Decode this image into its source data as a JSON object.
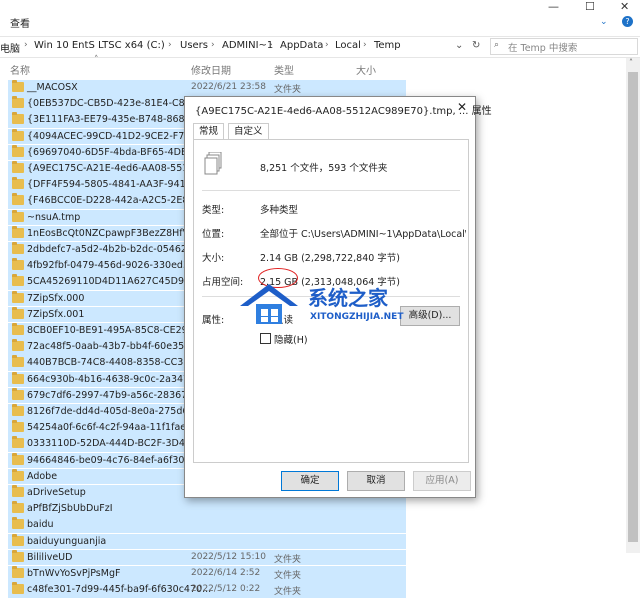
{
  "toolbar": {
    "view_menu": "查看"
  },
  "address": {
    "root": "电脑",
    "parts": [
      "Win 10 EntS LTSC x64 (C:)",
      "Users",
      "ADMINI~1",
      "AppData",
      "Local",
      "Temp"
    ]
  },
  "search": {
    "placeholder": "在 Temp 中搜索"
  },
  "columns": {
    "name": "名称",
    "modified": "修改日期",
    "type": "类型",
    "size": "大小"
  },
  "files": [
    {
      "name": "__MACOSX",
      "date": "2022/6/21 23:58",
      "type": "文件夹"
    },
    {
      "name": "{0EB537DC-CB5D-423e-81E4-C8A01A...",
      "date": "",
      "type": ""
    },
    {
      "name": "{3E111FA3-EE79-435e-B748-868E6DA...",
      "date": "",
      "type": ""
    },
    {
      "name": "{4094ACEC-99CD-41D2-9CE2-F7692C...",
      "date": "",
      "type": ""
    },
    {
      "name": "{69697040-6D5F-4bda-BF65-4DEC2B...",
      "date": "",
      "type": ""
    },
    {
      "name": "{A9EC175C-A21E-4ed6-AA08-5512AC...",
      "date": "",
      "type": ""
    },
    {
      "name": "{DFF4F594-5805-4841-AA3F-9410C28...",
      "date": "",
      "type": ""
    },
    {
      "name": "{F46BCC0E-D228-442a-A2C5-2E8B35...",
      "date": "",
      "type": ""
    },
    {
      "name": "~nsuA.tmp",
      "date": "",
      "type": ""
    },
    {
      "name": "1nEosBcQt0NZCpawpF3BezZ8HfV",
      "date": "",
      "type": ""
    },
    {
      "name": "2dbdefc7-a5d2-4b2b-b2dc-05462aa...",
      "date": "",
      "type": ""
    },
    {
      "name": "4fb92fbf-0479-456d-9026-330ed32d...",
      "date": "",
      "type": ""
    },
    {
      "name": "5CA45269110D4D11A627C45D97ECE...",
      "date": "",
      "type": ""
    },
    {
      "name": "7ZipSfx.000",
      "date": "",
      "type": ""
    },
    {
      "name": "7ZipSfx.001",
      "date": "",
      "type": ""
    },
    {
      "name": "8CB0EF10-BE91-495A-85C8-CE29188...",
      "date": "",
      "type": ""
    },
    {
      "name": "72ac48f5-0aab-43b7-bb4f-60e3568d...",
      "date": "",
      "type": ""
    },
    {
      "name": "440B7BCB-74C8-4408-8358-CC3BDD...",
      "date": "",
      "type": ""
    },
    {
      "name": "664c930b-4b16-4638-9c0c-2a347dcc...",
      "date": "",
      "type": ""
    },
    {
      "name": "679c7df6-2997-47b9-a56c-28367a1b...",
      "date": "",
      "type": ""
    },
    {
      "name": "8126f7de-dd4d-405d-8e0a-275d694...",
      "date": "",
      "type": ""
    },
    {
      "name": "54254a0f-6c6f-4c2f-94aa-11f1fae962...",
      "date": "",
      "type": ""
    },
    {
      "name": "0333110D-52DA-444D-BC2F-3D435B...",
      "date": "",
      "type": ""
    },
    {
      "name": "94664846-be09-4c76-84ef-a6f30c2f7...",
      "date": "",
      "type": ""
    },
    {
      "name": "Adobe",
      "date": "",
      "type": ""
    },
    {
      "name": "aDriveSetup",
      "date": "",
      "type": ""
    },
    {
      "name": "aPfBfZjSbUbDuFzI",
      "date": "",
      "type": ""
    },
    {
      "name": "baidu",
      "date": "",
      "type": ""
    },
    {
      "name": "baiduyunguanjia",
      "date": "",
      "type": ""
    },
    {
      "name": "BililiveUD",
      "date": "2022/5/12 15:10",
      "type": "文件夹"
    },
    {
      "name": "bTnWvYoSvPjPsMgF",
      "date": "2022/6/14 2:52",
      "type": "文件夹"
    },
    {
      "name": "c48fe301-7d99-445f-ba9f-6f630c470...",
      "date": "2022/5/12 0:22",
      "type": "文件夹"
    }
  ],
  "dialog": {
    "title": "{A9EC175C-A21E-4ed6-AA08-5512AC989E70}.tmp, ... 属性",
    "close": "✕",
    "tabs": [
      "常规",
      "自定义"
    ],
    "summary": "8,251 个文件，593 个文件夹",
    "type_label": "类型:",
    "type_value": "多种类型",
    "location_label": "位置:",
    "location_value": "全部位于 C:\\Users\\ADMINI~1\\AppData\\Local\\Tem",
    "size_label": "大小:",
    "size_value": "2.14 GB (2,298,722,840 字节)",
    "disk_label": "占用空间:",
    "disk_value": "2.15 GB (2,313,048,064 字节)",
    "attr_label": "属性:",
    "readonly_label": "只读",
    "hidden_label": "隐藏(H)",
    "advanced_button": "高级(D)...",
    "ok": "确定",
    "cancel": "取消",
    "apply": "应用(A)"
  },
  "watermark": {
    "text": "系统之家",
    "url": "XITONGZHIJIA.NET"
  },
  "colors": {
    "selection": "#cce8ff",
    "folder": "#e8bd4e",
    "highlight_circle": "#e02020",
    "watermark_blue": "#1e5ec8"
  }
}
